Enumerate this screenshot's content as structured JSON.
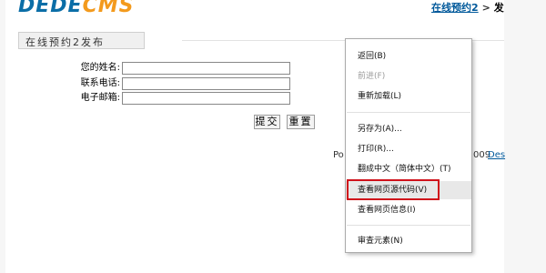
{
  "logo": {
    "part1": "DEDE",
    "part2": "CMS"
  },
  "breadcrumb": {
    "link": "在线预约2",
    "sep": ">",
    "tail": "发"
  },
  "form": {
    "title": "在线预约2发布",
    "fields": [
      {
        "label": "您的姓名:",
        "value": ""
      },
      {
        "label": "联系电话:",
        "value": ""
      },
      {
        "label": "电子邮箱:",
        "value": ""
      }
    ],
    "submit_label": "提交",
    "reset_label": "重置"
  },
  "footer": {
    "powered_prefix": "Po",
    "year_suffix": "009",
    "link_text": "Des"
  },
  "context_menu": {
    "items": [
      {
        "label": "返回(B)",
        "enabled": true
      },
      {
        "label": "前进(F)",
        "enabled": false
      },
      {
        "label": "重新加载(L)",
        "enabled": true
      },
      {
        "label": "另存为(A)...",
        "enabled": true
      },
      {
        "label": "打印(R)...",
        "enabled": true
      },
      {
        "label": "翻成中文（简体中文）(T)",
        "enabled": true
      },
      {
        "label": "查看网页源代码(V)",
        "enabled": true,
        "highlighted": true
      },
      {
        "label": "查看网页信息(I)",
        "enabled": true
      },
      {
        "label": "审查元素(N)",
        "enabled": true
      }
    ]
  },
  "colors": {
    "highlight": "#d0121b",
    "link": "#00599b",
    "logo_blue": "#0b6ea7",
    "logo_orange": "#f39a1d"
  }
}
